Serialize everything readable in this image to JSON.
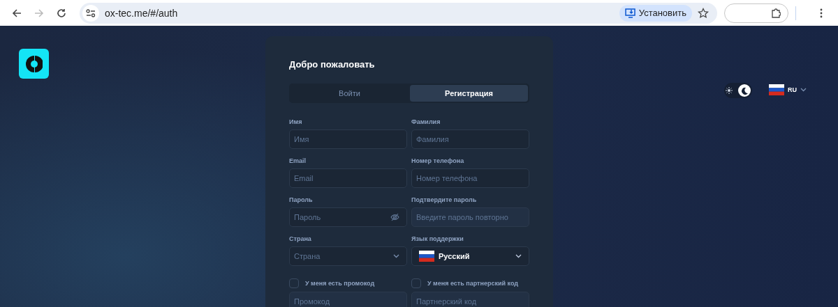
{
  "browser": {
    "url": "ox-tec.me/#/auth",
    "install_label": "Установить"
  },
  "theme_toggle": {
    "dark": true
  },
  "language": {
    "code": "RU"
  },
  "card": {
    "title": "Добро пожаловать",
    "tabs": [
      {
        "label": "Войти",
        "selected": false
      },
      {
        "label": "Регистрация",
        "selected": true
      }
    ],
    "fields": [
      {
        "kind": "text",
        "label": "Имя",
        "placeholder": "Имя",
        "disabled": false
      },
      {
        "kind": "text",
        "label": "Фамилия",
        "placeholder": "Фамилия",
        "disabled": false
      },
      {
        "kind": "text",
        "label": "Email",
        "placeholder": "Email",
        "disabled": false
      },
      {
        "kind": "text",
        "label": "Номер телефона",
        "placeholder": "Номер телефона",
        "disabled": false
      },
      {
        "kind": "password",
        "label": "Пароль",
        "placeholder": "Пароль",
        "disabled": false
      },
      {
        "kind": "text",
        "label": "Подтвердите пароль",
        "placeholder": "Введите пароль повторно",
        "disabled": true
      },
      {
        "kind": "select",
        "label": "Страна",
        "placeholder": "Страна",
        "disabled": false
      },
      {
        "kind": "language",
        "label": "Язык поддержки",
        "value": "Русский",
        "disabled": false
      }
    ],
    "checkboxes": [
      {
        "label": "У меня есть промокод",
        "checked": false,
        "placeholder": "Промокод",
        "disabled": true
      },
      {
        "label": "У меня есть партнерский код",
        "checked": false,
        "placeholder": "Партнерский код",
        "disabled": true
      }
    ]
  }
}
